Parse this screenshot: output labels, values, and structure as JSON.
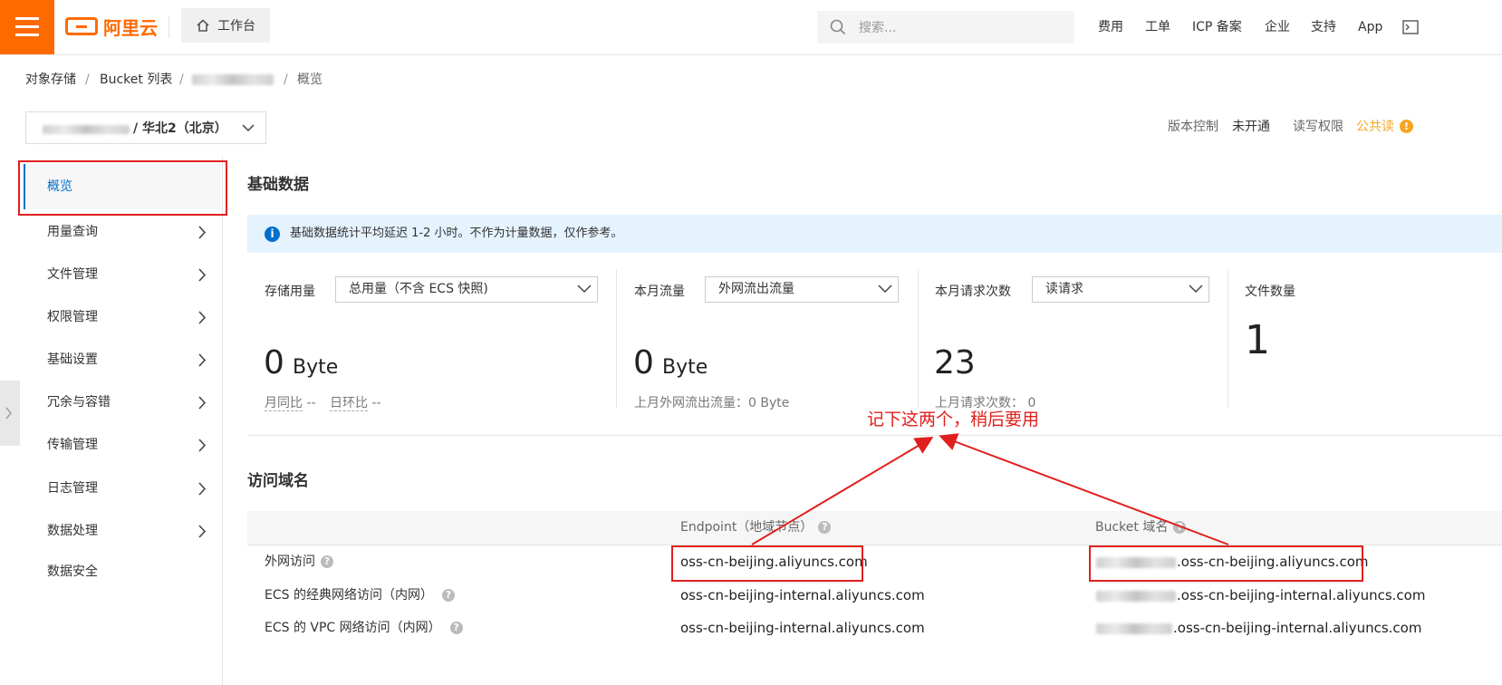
{
  "topbar": {
    "brand": "阿里云",
    "workbench": "工作台",
    "search_placeholder": "搜索...",
    "nav": [
      "费用",
      "工单",
      "ICP 备案",
      "企业",
      "支持",
      "App"
    ]
  },
  "breadcrumb": {
    "items": [
      "对象存储",
      "Bucket 列表",
      "概览"
    ],
    "separator": "/"
  },
  "bucket_selector": {
    "region_text": "/ 华北2（北京）"
  },
  "bucket_meta": {
    "version_label": "版本控制",
    "version_value": "未开通",
    "acl_label": "读写权限",
    "acl_value": "公共读",
    "acl_color": "#f5a623"
  },
  "sidebar": {
    "active": "概览",
    "items": [
      "用量查询",
      "文件管理",
      "权限管理",
      "基础设置",
      "冗余与容错",
      "传输管理",
      "日志管理",
      "数据处理",
      "数据安全"
    ]
  },
  "basic": {
    "title": "基础数据",
    "info": "基础数据统计平均延迟 1-2 小时。不作为计量数据，仅作参考。",
    "storage": {
      "label": "存储用量",
      "select": "总用量（不含 ECS 快照)",
      "value": "0",
      "unit": "Byte",
      "mom_label": "月同比",
      "mom_value": "--",
      "dod_label": "日环比",
      "dod_value": "--"
    },
    "traffic": {
      "label": "本月流量",
      "select": "外网流出流量",
      "value": "0",
      "unit": "Byte",
      "sub": "上月外网流出流量：0 Byte"
    },
    "requests": {
      "label": "本月请求次数",
      "select": "读请求",
      "value": "23",
      "sub": "上月请求次数： 0"
    },
    "files": {
      "label": "文件数量",
      "value": "1"
    }
  },
  "annotation": "记下这两个，稍后要用",
  "domains": {
    "title": "访问域名",
    "col_endpoint": "Endpoint（地域节点）",
    "col_bucket": "Bucket 域名",
    "rows": [
      {
        "label": "外网访问",
        "endpoint": "oss-cn-beijing.aliyuncs.com",
        "bucket": ".oss-cn-beijing.aliyuncs.com"
      },
      {
        "label": "ECS 的经典网络访问（内网）",
        "endpoint": "oss-cn-beijing-internal.aliyuncs.com",
        "bucket": ".oss-cn-beijing-internal.aliyuncs.com"
      },
      {
        "label": "ECS 的 VPC 网络访问（内网）",
        "endpoint": "oss-cn-beijing-internal.aliyuncs.com",
        "bucket": ".oss-cn-beijing-internal.aliyuncs.com"
      }
    ]
  },
  "colors": {
    "brand": "#ff6a00",
    "link": "#0070cc",
    "highlight": "#e0201e"
  }
}
